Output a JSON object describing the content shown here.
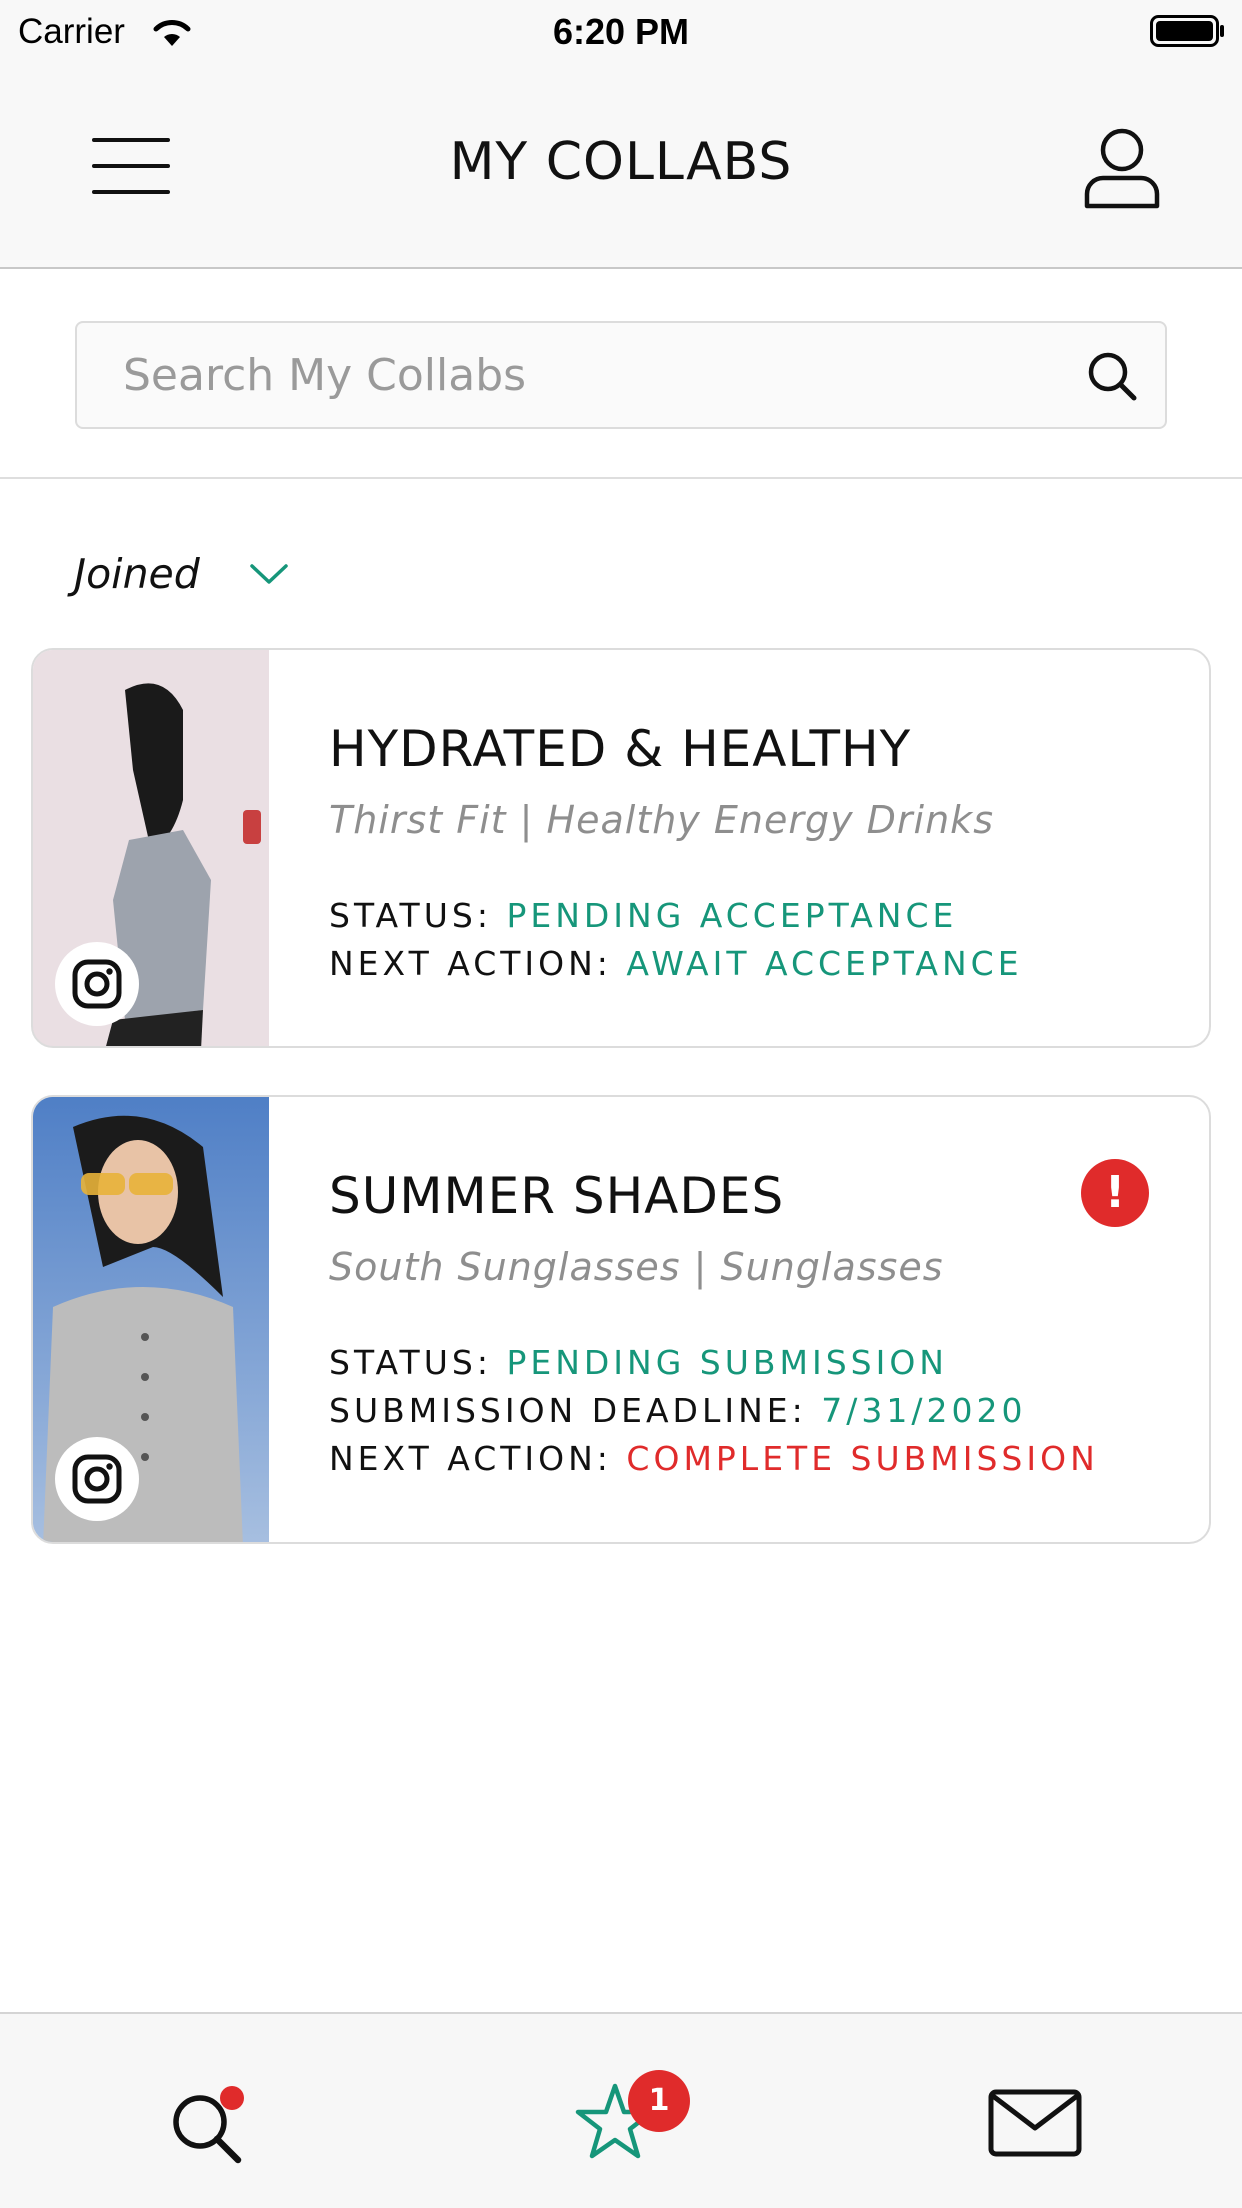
{
  "status_bar": {
    "carrier": "Carrier",
    "time": "6:20 PM"
  },
  "header": {
    "title": "MY COLLABS",
    "menu_icon": "hamburger-icon",
    "profile_icon": "user-profile-icon"
  },
  "search": {
    "placeholder": "Search My Collabs",
    "value": ""
  },
  "filter": {
    "selected": "Joined"
  },
  "collabs": [
    {
      "title": "HYDRATED & HEALTHY",
      "subtitle": "Thirst Fit | Healthy Energy Drinks",
      "platform": "instagram",
      "status_label": "STATUS:",
      "status": "PENDING ACCEPTANCE",
      "next_action_label": "NEXT ACTION:",
      "next_action": "AWAIT ACCEPTANCE"
    },
    {
      "title": "SUMMER SHADES",
      "subtitle": "South Sunglasses | Sunglasses",
      "platform": "instagram",
      "alert": "!",
      "status_label": "STATUS:",
      "status": "PENDING SUBMISSION",
      "deadline_label": "SUBMISSION DEADLINE:",
      "deadline": "7/31/2020",
      "next_action_label": "NEXT ACTION:",
      "next_action": "COMPLETE SUBMISSION"
    }
  ],
  "tab_bar": {
    "search_icon": "search-icon",
    "collabs_icon": "star-icon",
    "collabs_badge": "1",
    "messages_icon": "envelope-icon"
  },
  "colors": {
    "accent_green": "#16967a",
    "alert_red": "#e02b2b"
  }
}
